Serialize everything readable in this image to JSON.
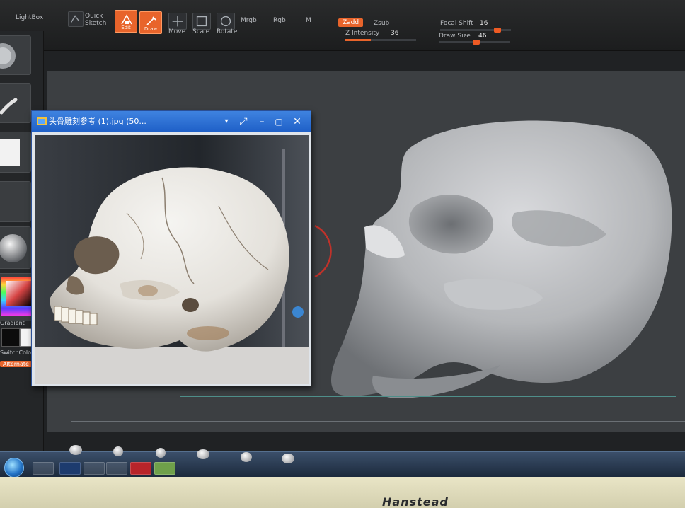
{
  "toolbar": {
    "lightbox_label": "LightBox",
    "quick_sketch_label": "Quick Sketch",
    "edit_label": "Edit",
    "draw_label": "Draw",
    "move_label": "Move",
    "scale_label": "Scale",
    "rotate_label": "Rotate",
    "mrgb_label": "Mrgb",
    "rgb_label": "Rgb",
    "m_label": "M",
    "zadd_label": "Zadd",
    "zsub_label": "Zsub",
    "z_intensity_label": "Z Intensity",
    "z_intensity_value": "36",
    "z_intensity_fraction": 0.36,
    "focal_shift_label": "Focal Shift",
    "focal_shift_value": "16",
    "draw_size_label": "Draw Size",
    "draw_size_value": "46",
    "accent_color": "#e8642b"
  },
  "left_tray": {
    "gradient_label": "Gradient",
    "switch_color_label": "SwitchColor",
    "alternate_label": "Alternate"
  },
  "viewer": {
    "title": "头骨雕刻参考 (1).jpg (50...",
    "minimize_icon": "minimize-icon",
    "maximize_icon": "maximize-icon",
    "close_icon": "close-icon",
    "dropdown_icon": "dropdown-icon",
    "fullscreen_icon": "fullscreen-icon",
    "titlebar_color": "#2d6fd6"
  },
  "taskbar": {
    "buttons": [
      "explorer-icon",
      "photoshop-icon",
      "window-icon",
      "viewer-icon",
      "app-icon",
      "color-icon"
    ]
  },
  "monitor": {
    "brand": "Hanstead"
  }
}
